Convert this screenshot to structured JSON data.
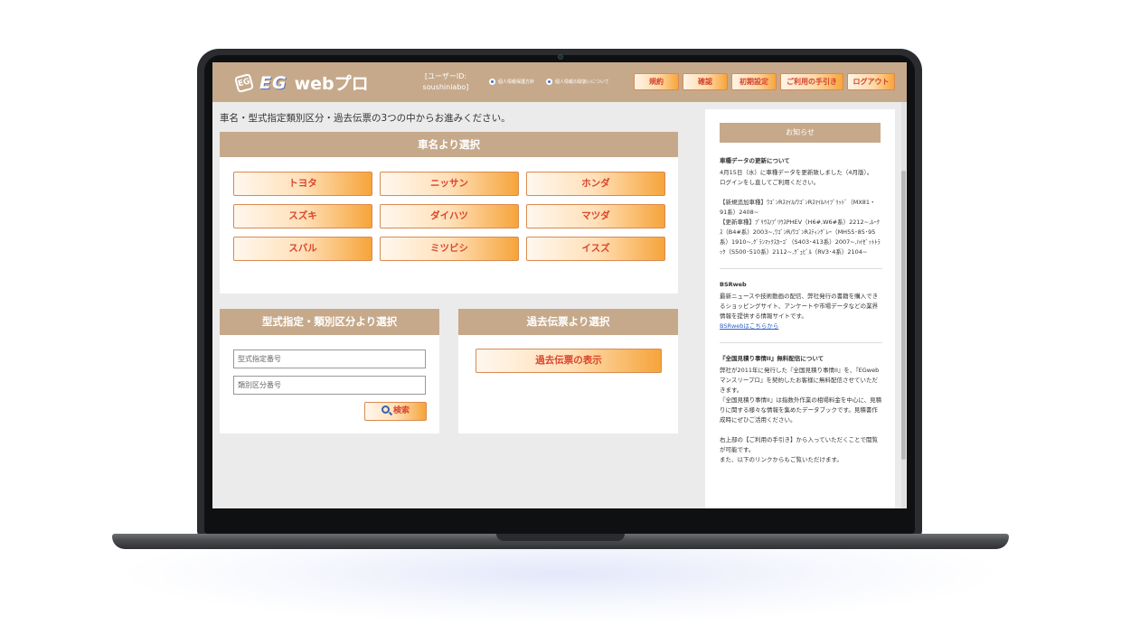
{
  "header": {
    "logo_brand": "EG",
    "logo_suffix": "webプロ",
    "user_id_line1": "[ユーザーID:",
    "user_id_line2": "soushiniabo]",
    "privacy_links": [
      "個人情報保護方針",
      "個人情報の取扱いについて"
    ],
    "nav_buttons": [
      "規約",
      "確認",
      "初期設定",
      "ご利用の手引き",
      "ログアウト"
    ]
  },
  "intro_text": "車名・型式指定類別区分・過去伝票の3つの中からお進みください。",
  "maker_panel": {
    "title": "車名より選択",
    "makers": [
      "トヨタ",
      "ニッサン",
      "ホンダ",
      "スズキ",
      "ダイハツ",
      "マツダ",
      "スバル",
      "ミツビシ",
      "イスズ"
    ]
  },
  "type_panel": {
    "title": "型式指定・類別区分より選択",
    "type_placeholder": "型式指定番号",
    "class_placeholder": "類別区分番号",
    "search_label": "検索"
  },
  "history_panel": {
    "title": "過去伝票より選択",
    "button_label": "過去伝票の表示"
  },
  "news": {
    "heading": "お知らせ",
    "item1_title": "車種データの更新について",
    "item1_p1": "4月15日（水）に車種データを更新致しました（4月版）。",
    "item1_p2": "ログインをし直してご利用ください。",
    "item1_p3": "【新規追加車種】ﾜｺﾞﾝRｽﾏｲﾙ/ﾜｺﾞﾝRｽﾏｲﾙﾊｲﾌﾞﾘｯﾄﾞ（MX81・91系）2408~",
    "item1_p4": "【更新車種】ﾌﾟﾘｳｽ/ﾌﾟﾘｳｽPHEV（H6#,W6#系）2212~,ﾙｰｸｽ（B4#系）2003~,ﾜｺﾞﾝR/ﾜｺﾞﾝRｽﾃｨﾝｸﾞﾚｰ（MH55･85･95系）1910~,ｸﾞﾗﾝﾏｯｸｽｶｰｺﾞ（S403･413系）2007~,ﾊｲｾﾞｯﾄﾄﾗｯｸ（S500･510系）2112~,ｸﾞｪﾋﾞﾙ（RV3･4系）2104~",
    "item2_title": "BSRweb",
    "item2_p1": "最新ニュースや技術動画の配信、弊社発行の書籍を購入できるショッピングサイト、アンケートや市場データなどの業界情報を提供する情報サイトです。",
    "item2_link": "BSRwebはこちらから",
    "item3_title": "『全国見積り事情II』無料配信について",
    "item3_p1": "弊社が2011年に発行した『全国見積り事情II』を、『EGwebマンスリープロ』を契約したお客様に無料配信させていただきます。",
    "item3_p2": "『全国見積り事情II』は指数外作業の相場料金を中心に、見積りに関する様々な情報を集めたデータブックです。見積書作成時にぜひご活用ください。",
    "item3_p3": "右上部の【ご利用の手引き】から入っていただくことで閲覧が可能です。",
    "item3_p4": "また、以下のリンクからもご覧いただけます。"
  }
}
